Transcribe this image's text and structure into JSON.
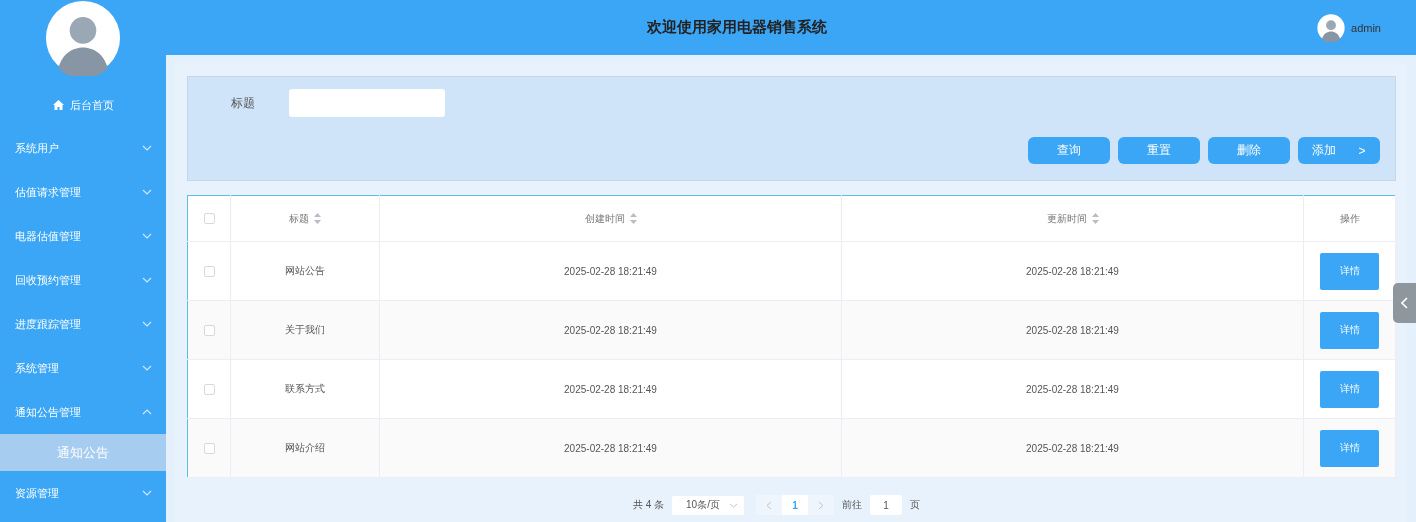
{
  "header": {
    "title": "欢迎使用家用电器销售系统",
    "user": "admin"
  },
  "sidebar": {
    "home": "后台首页",
    "items": [
      {
        "label": "系统用户",
        "expanded": false
      },
      {
        "label": "估值请求管理",
        "expanded": false
      },
      {
        "label": "电器估值管理",
        "expanded": false
      },
      {
        "label": "回收预约管理",
        "expanded": false
      },
      {
        "label": "进度跟踪管理",
        "expanded": false
      },
      {
        "label": "系统管理",
        "expanded": false
      },
      {
        "label": "通知公告管理",
        "expanded": true,
        "children": [
          {
            "label": "通知公告",
            "selected": true
          }
        ]
      },
      {
        "label": "资源管理",
        "expanded": false
      }
    ]
  },
  "search": {
    "label": "标题",
    "buttons": [
      {
        "label": "查询"
      },
      {
        "label": "重置"
      },
      {
        "label": "删除"
      },
      {
        "label": "添加",
        "suffix": ">"
      }
    ]
  },
  "table": {
    "all_checked": false,
    "columns": [
      "标题",
      "创建时间",
      "更新时间",
      "操作"
    ],
    "rows": [
      {
        "checked": false,
        "title": "网站公告",
        "created": "2025-02-28 18:21:49",
        "updated": "2025-02-28 18:21:49",
        "action": "详情"
      },
      {
        "checked": false,
        "title": "关于我们",
        "created": "2025-02-28 18:21:49",
        "updated": "2025-02-28 18:21:49",
        "action": "详情"
      },
      {
        "checked": false,
        "title": "联系方式",
        "created": "2025-02-28 18:21:49",
        "updated": "2025-02-28 18:21:49",
        "action": "详情"
      },
      {
        "checked": false,
        "title": "网站介绍",
        "created": "2025-02-28 18:21:49",
        "updated": "2025-02-28 18:21:49",
        "action": "详情"
      }
    ]
  },
  "pagination": {
    "total": "共 4 条",
    "page_size": "10条/页",
    "pages": [
      {
        "label": "1",
        "selected": true
      }
    ],
    "goto_label": "前往",
    "goto_value": "1",
    "goto_suffix": "页"
  }
}
